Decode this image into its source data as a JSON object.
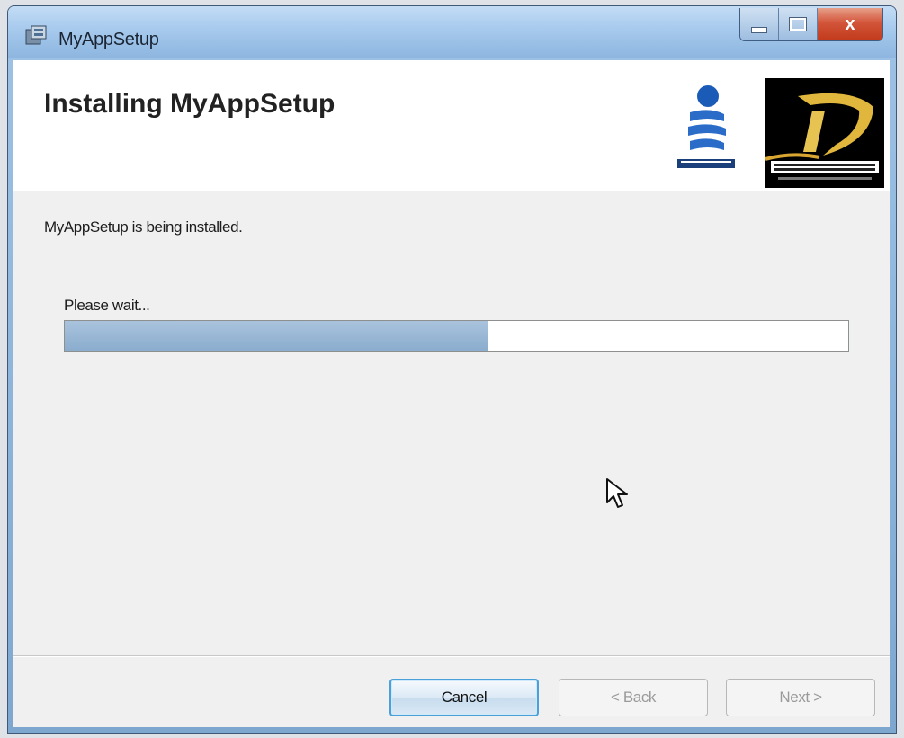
{
  "window": {
    "title": "MyAppSetup",
    "close_glyph": "x",
    "accent_color": "#8cb5df"
  },
  "banner": {
    "title": "Installing MyAppSetup"
  },
  "body": {
    "status_text": "MyAppSetup is being installed.",
    "wait_label": "Please wait...",
    "progress_fraction": 0.54
  },
  "buttons": {
    "cancel": "Cancel",
    "back": "< Back",
    "next": "Next >"
  },
  "icons": {
    "app": "installer-icon",
    "cursor": "mouse-pointer-icon",
    "logo1": "blue-stack-logo",
    "logo2": "dev-book-logo"
  }
}
